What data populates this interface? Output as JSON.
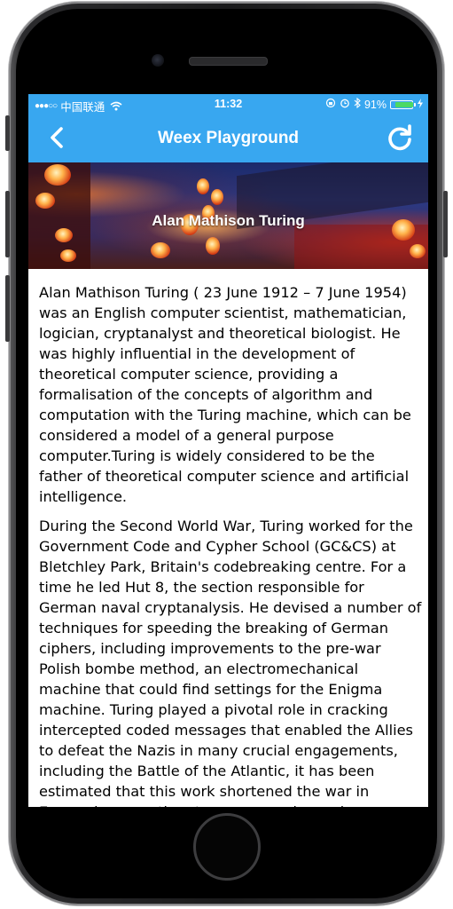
{
  "status_bar": {
    "signal": "●●●○○",
    "carrier": "中国联通",
    "time": "11:32",
    "battery_percent": "91%",
    "battery_level": 0.91,
    "battery_color": "#4cd964"
  },
  "nav_bar": {
    "title": "Weex Playground",
    "back_icon": "chevron-left-icon",
    "refresh_icon": "refresh-icon",
    "color": "#38a7f0"
  },
  "banner": {
    "title": "Alan Mathison Turing"
  },
  "article": {
    "paragraphs": [
      "Alan Mathison Turing ( 23 June 1912 – 7 June 1954) was an English computer scientist, mathematician, logician, cryptanalyst and theoretical biologist. He was highly influential in the development of theoretical computer science, providing a formalisation of the concepts of algorithm and computation with the Turing machine, which can be considered a model of a general purpose computer.Turing is widely considered to be the father of theoretical computer science and artificial intelligence.",
      "During the Second World War, Turing worked for the Government Code and Cypher School (GC&CS) at Bletchley Park, Britain's codebreaking centre. For a time he led Hut 8, the section responsible for German naval cryptanalysis. He devised a number of techniques for speeding the breaking of German ciphers, including improvements to the pre-war Polish bombe method, an electromechanical machine that could find settings for the Enigma machine. Turing played a pivotal role in cracking intercepted coded messages that enabled the Allies to defeat the Nazis in many crucial engagements, including the Battle of the Atlantic, it has been estimated that this work shortened the war in Europe by more than two years and saved over fourteen million lives."
    ]
  }
}
